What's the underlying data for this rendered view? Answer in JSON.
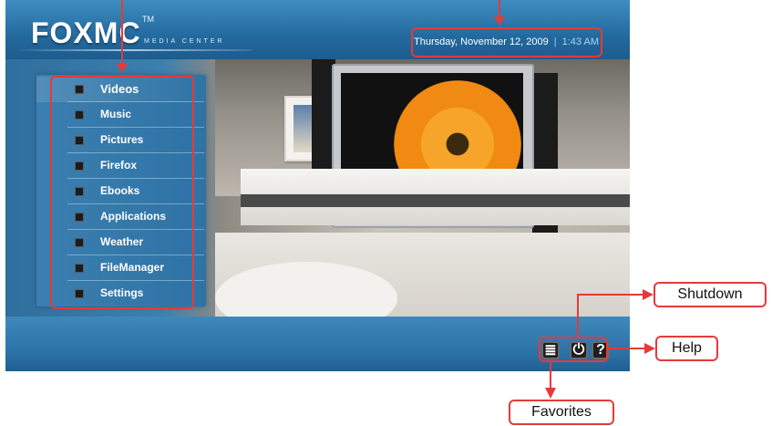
{
  "app": {
    "logo": "FOXMC",
    "tm": "TM",
    "subtitle": "MEDIA CENTER"
  },
  "header": {
    "date": "Thursday, November 12, 2009",
    "separator": "|",
    "time": "1:43 AM"
  },
  "menu": {
    "items": [
      {
        "label": "Videos",
        "selected": true
      },
      {
        "label": "Music"
      },
      {
        "label": "Pictures"
      },
      {
        "label": "Firefox"
      },
      {
        "label": "Ebooks"
      },
      {
        "label": "Applications"
      },
      {
        "label": "Weather"
      },
      {
        "label": "FileManager"
      },
      {
        "label": "Settings"
      }
    ]
  },
  "footer": {
    "favorites_glyph": "≣",
    "shutdown_glyph": "⏻",
    "help_glyph": "?"
  },
  "callouts": {
    "shutdown": "Shutdown",
    "help": "Help",
    "favorites": "Favorites"
  },
  "colors": {
    "accent_blue": "#2b71a6",
    "annotation_red": "#e53a3a"
  }
}
